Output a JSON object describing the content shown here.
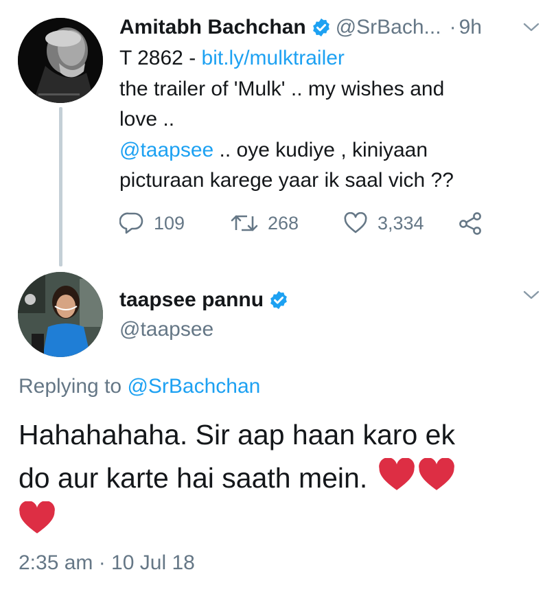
{
  "tweet1": {
    "author_name": "Amitabh Bachchan",
    "author_handle": "@SrBach...",
    "separator": "·",
    "time": "9h",
    "lines": {
      "l1_prefix": "T 2862 - ",
      "l1_link": "bit.ly/mulktrailer",
      "l2": "the trailer of 'Mulk' .. my wishes and",
      "l3": "love ..",
      "l4_mention": "@taapsee",
      "l4_rest": " .. oye kudiye , kiniyaan",
      "l5": "picturaan karege yaar ik saal vich ??"
    },
    "actions": {
      "replies": "109",
      "retweets": "268",
      "likes": "3,334"
    },
    "icons": [
      "verified-badge-icon",
      "chevron-down-icon",
      "reply-icon",
      "retweet-icon",
      "like-icon",
      "share-icon"
    ]
  },
  "tweet2": {
    "author_name": "taapsee pannu",
    "author_handle": "@taapsee",
    "replying_prefix": "Replying to ",
    "replying_handle": "@SrBachchan",
    "lines": {
      "l1": "Hahahahaha. Sir aap haan karo ek",
      "l2": "do aur karte hai saath mein. "
    },
    "emoji": [
      "red-heart",
      "red-heart",
      "red-heart"
    ],
    "timestamp": "2:35 am · 10 Jul 18"
  },
  "colors": {
    "text": "#14171a",
    "secondary": "#657786",
    "link": "#1da1f2",
    "verified": "#1da1f2",
    "thread_line": "#c4cfd6",
    "heart": "#dd2e44"
  }
}
